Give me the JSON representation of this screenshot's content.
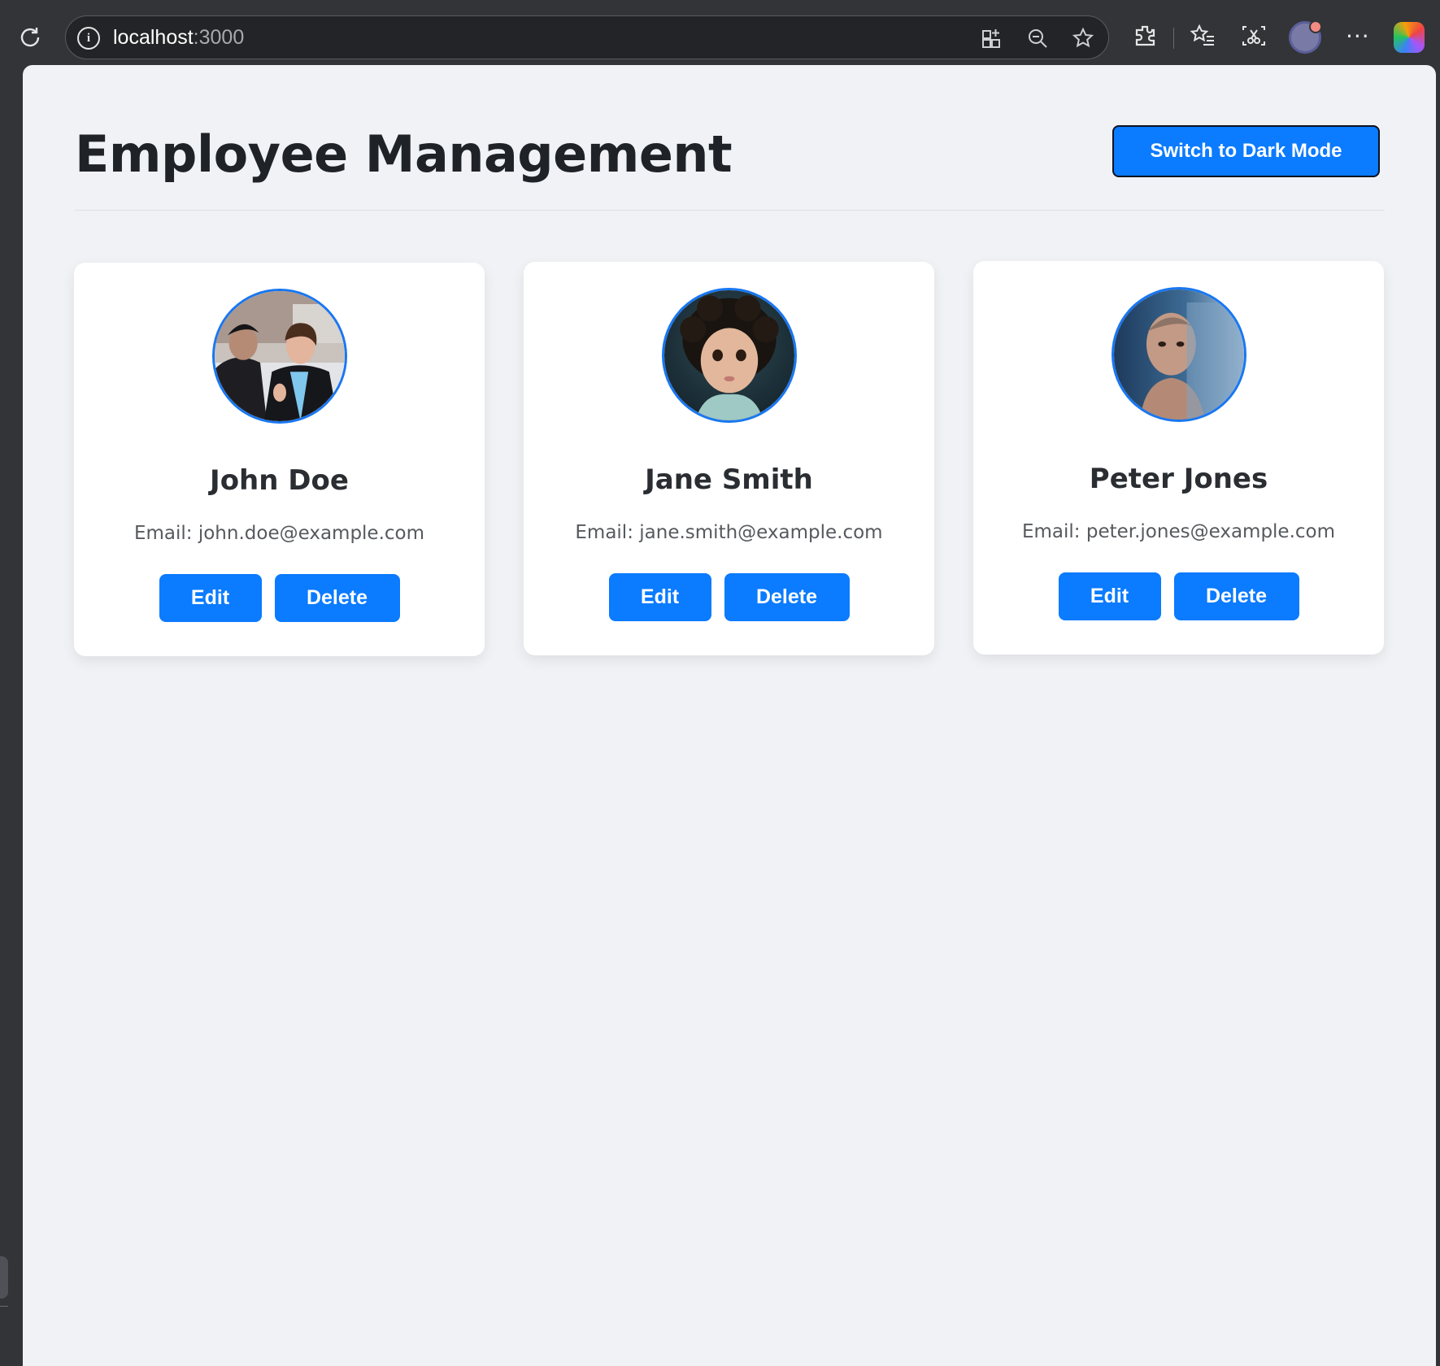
{
  "browser": {
    "url_host": "localhost",
    "url_port": ":3000",
    "icons": {
      "reload": "reload-icon",
      "site_info": "info-icon",
      "apps": "apps-icon",
      "zoom": "zoom-out-icon",
      "favorite": "star-icon",
      "extensions": "extensions-icon",
      "favorites_list": "favorites-icon",
      "screenshot": "screenshot-icon",
      "profile": "profile-icon",
      "more": "more-icon",
      "copilot": "copilot-icon"
    },
    "more_label": "···"
  },
  "page": {
    "title": "Employee Management",
    "theme_toggle_label": "Switch to Dark Mode",
    "colors": {
      "background": "#f0f2f5",
      "accent": "#0b7bff",
      "card": "#ffffff",
      "avatar_ring": "#1877f2"
    }
  },
  "employees": [
    {
      "name": "John Doe",
      "email": "Email: john.doe@example.com",
      "photo": "two-men-outdoors-photo",
      "edit_label": "Edit",
      "delete_label": "Delete"
    },
    {
      "name": "Jane Smith",
      "email": "Email: jane.smith@example.com",
      "photo": "curly-haired-child-photo",
      "edit_label": "Edit",
      "delete_label": "Delete"
    },
    {
      "name": "Peter Jones",
      "email": "Email: peter.jones@example.com",
      "photo": "man-smoke-portrait-photo",
      "edit_label": "Edit",
      "delete_label": "Delete"
    }
  ]
}
